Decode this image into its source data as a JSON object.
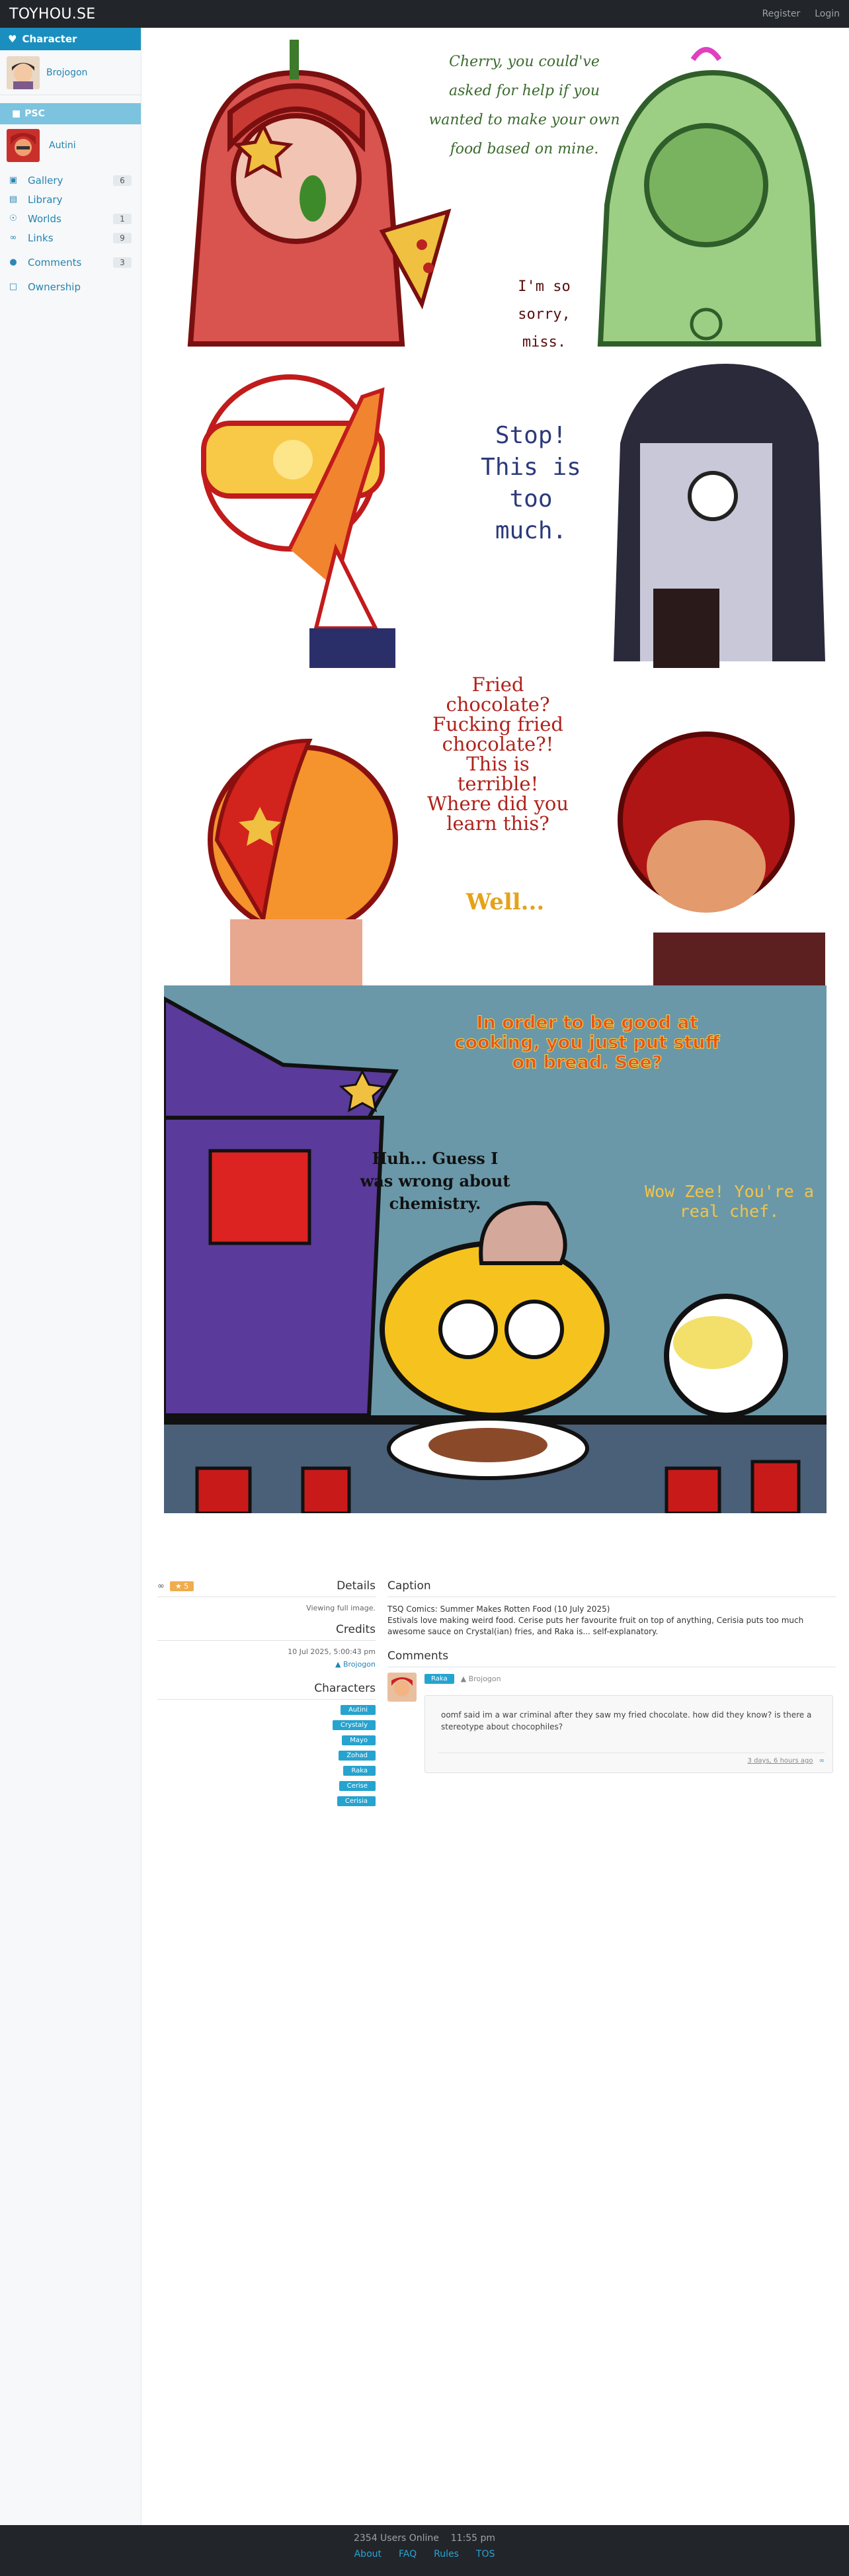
{
  "brand": "TOYHOU.SE",
  "topnav": {
    "register": "Register",
    "login": "Login"
  },
  "sidebar": {
    "header": "Character",
    "owner_name": "Brojogon",
    "folder": "PSC",
    "character_name": "Autini",
    "items": [
      {
        "label": "Gallery",
        "count": "6",
        "icon": "image-icon"
      },
      {
        "label": "Library",
        "count": "",
        "icon": "book-icon"
      },
      {
        "label": "Worlds",
        "count": "1",
        "icon": "globe-icon"
      },
      {
        "label": "Links",
        "count": "9",
        "icon": "link-icon"
      },
      {
        "label": "Comments",
        "count": "3",
        "icon": "comment-icon"
      },
      {
        "label": "Ownership",
        "count": "",
        "icon": "ownership-icon"
      }
    ]
  },
  "comic": {
    "panel1_speech": "Cherry, you could've asked for help if you wanted to make your own food based on mine.",
    "panel1_reply": "I'm so sorry, miss.",
    "panel2_speech": "Stop! This is too much.",
    "panel3_speech": "Fried chocolate? Fucking fried chocolate?! This is terrible! Where did you learn this?",
    "panel3_reply": "Well...",
    "panel4_speech1": "In order to be good at cooking, you just put stuff on bread. See?",
    "panel4_speech2": "Huh... Guess I was wrong about chemistry.",
    "panel4_speech3": "Wow Zee! You're a real chef."
  },
  "details": {
    "fav_count": "5",
    "details_title": "Details",
    "viewing": "Viewing full image.",
    "credits_title": "Credits",
    "date": "10 Jul 2025, 5:00:43 pm",
    "credit_user": "Brojogon",
    "characters_title": "Characters",
    "characters": [
      "Autini",
      "Crystaly",
      "Mayo",
      "Zohad",
      "Raka",
      "Cerise",
      "Cerisia"
    ]
  },
  "caption": {
    "title": "Caption",
    "line1": "TSQ Comics: Summer Makes Rotten Food (10 July 2025)",
    "line2": "Estivals love making weird food. Cerise puts her favourite fruit on top of anything, Cerisia puts too much awesome sauce on Crystal(ian) fries, and Raka is... self-explanatory."
  },
  "comments": {
    "title": "Comments",
    "author_tag": "Raka",
    "owner": "Brojogon",
    "text": "oomf said im a war criminal after they saw my fried chocolate. how did they know? is there a stereotype about chocophiles?",
    "time": "3 days, 6 hours ago"
  },
  "footer": {
    "online": "2354 Users Online",
    "time": "11:55 pm",
    "links": [
      "About",
      "FAQ",
      "Rules",
      "TOS"
    ]
  },
  "colors": {
    "accent": "#1a8fbf",
    "topbar": "#222529",
    "link": "#2285b4",
    "panel4_bg": "#6a98a8"
  }
}
